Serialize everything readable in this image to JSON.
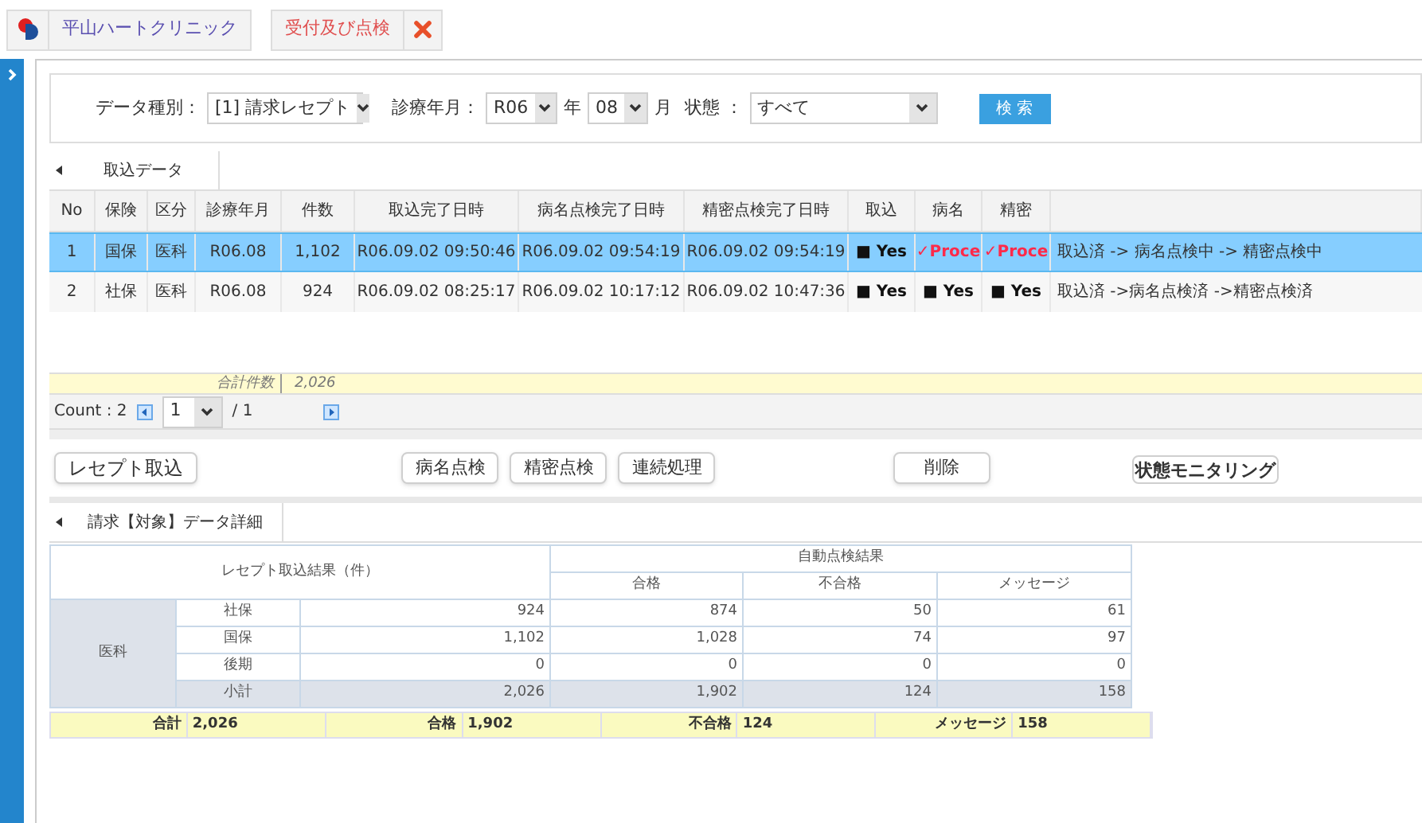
{
  "header": {
    "clinic": "平山ハートクリニック",
    "active_tab": "受付及び点検"
  },
  "filters": {
    "data_type_label": "データ種別：",
    "data_type": "[1] 請求レセプト",
    "month_label": "診療年月：",
    "era_year": "R06",
    "year_unit": "年",
    "month": "08",
    "month_unit": "月",
    "status_label": "状態 ：",
    "status": "すべて",
    "search_button": "検 索"
  },
  "import_tab": {
    "label": "取込データ",
    "selected": true
  },
  "table": {
    "columns": [
      "No",
      "保険",
      "区分",
      "診療年月",
      "件数",
      "取込完了日時",
      "病名点検完了日時",
      "精密点検完了日時",
      "取込",
      "病名",
      "精密",
      ""
    ],
    "rows": [
      {
        "selected": true,
        "cells": [
          "1",
          "国保",
          "医科",
          "R06.08",
          "1,102",
          "R06.09.02 09:50:46",
          "R06.09.02 09:54:19",
          "R06.09.02 09:54:19"
        ],
        "flags": [
          {
            "kind": "done",
            "text": "■ Yes"
          },
          {
            "kind": "processing",
            "text": "✓Proce"
          },
          {
            "kind": "processing",
            "text": "✓Proce"
          }
        ],
        "status": "取込済 -> 病名点検中 -> 精密点検中"
      },
      {
        "selected": false,
        "cells": [
          "2",
          "社保",
          "医科",
          "R06.08",
          "924",
          "R06.09.02 08:25:17",
          "R06.09.02 10:17:12",
          "R06.09.02 10:47:36"
        ],
        "flags": [
          {
            "kind": "done",
            "text": "■ Yes"
          },
          {
            "kind": "done",
            "text": "■ Yes"
          },
          {
            "kind": "done",
            "text": "■ Yes"
          }
        ],
        "status": "取込済 ->病名点検済 ->精密点検済"
      }
    ],
    "total_label": "合計件数",
    "total_value": "2,026"
  },
  "pager": {
    "count": "Count : 2",
    "page": "1",
    "of": "/ 1"
  },
  "buttons": [
    {
      "label": "レセプト取込",
      "kind": "left"
    },
    {
      "label": "病名点検",
      "kind": "middle"
    },
    {
      "label": "精密点検",
      "kind": "middle"
    },
    {
      "label": "連続処理",
      "kind": "middle"
    },
    {
      "label": "削除",
      "kind": "delete"
    },
    {
      "label": "状態モニタリング",
      "kind": "monitor"
    }
  ],
  "detail_tab": {
    "label": "請求【対象】データ詳細",
    "selected": true
  },
  "detail": {
    "import_header": "レセプト取込結果（件）",
    "check_header": "自動点検結果",
    "check_columns": [
      "合格",
      "不合格",
      "メッセージ"
    ],
    "category": "医科",
    "rows": [
      {
        "kind": "item",
        "name": "社保",
        "values": [
          "924",
          "874",
          "50",
          "61"
        ]
      },
      {
        "kind": "item",
        "name": "国保",
        "values": [
          "1,102",
          "1,028",
          "74",
          "97"
        ]
      },
      {
        "kind": "item",
        "name": "後期",
        "values": [
          "0",
          "0",
          "0",
          "0"
        ]
      },
      {
        "kind": "subtotal",
        "name": "小計",
        "values": [
          "2,026",
          "1,902",
          "124",
          "158"
        ]
      }
    ],
    "summary": [
      {
        "label": "合計",
        "value": "2,026"
      },
      {
        "label": "合格",
        "value": "1,902"
      },
      {
        "label": "不合格",
        "value": "124"
      },
      {
        "label": "メッセージ",
        "value": "158"
      }
    ]
  }
}
